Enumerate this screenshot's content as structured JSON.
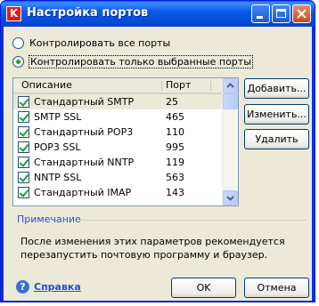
{
  "window": {
    "title": "Настройка портов",
    "app_icon_letter": "K",
    "minimize": "_",
    "maximize": "□",
    "close": "✕"
  },
  "options": {
    "all_ports": "Контролировать все порты",
    "selected_ports": "Контролировать только выбранные порты",
    "selected": "selected_ports"
  },
  "list": {
    "col_description": "Описание",
    "col_port": "Порт",
    "rows": [
      {
        "name": "Стандартный SMTP",
        "port": "25",
        "checked": true
      },
      {
        "name": "SMTP SSL",
        "port": "465",
        "checked": true
      },
      {
        "name": "Стандартный POP3",
        "port": "110",
        "checked": true
      },
      {
        "name": "POP3 SSL",
        "port": "995",
        "checked": true
      },
      {
        "name": "Стандартный NNTP",
        "port": "119",
        "checked": true
      },
      {
        "name": "NNTP SSL",
        "port": "563",
        "checked": true
      },
      {
        "name": "Стандартный IMAP",
        "port": "143",
        "checked": true
      }
    ]
  },
  "buttons": {
    "add": "Добавить...",
    "edit": "Изменить...",
    "delete": "Удалить",
    "ok": "OK",
    "cancel": "Отмена"
  },
  "note": {
    "label": "Примечание",
    "text": "После изменения этих параметров рекомендуется перезапустить почтовую программу и браузер."
  },
  "help": {
    "label": "Справка"
  },
  "colors": {
    "titlebar": "#0a5bea",
    "dialog_bg": "#ece9d8",
    "link": "#1f56c8",
    "check": "#21a121"
  }
}
